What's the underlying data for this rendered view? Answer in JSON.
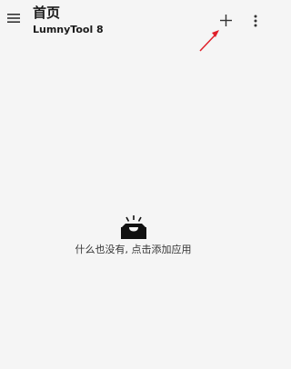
{
  "header": {
    "title": "首页",
    "subtitle": "LumnyTool 8"
  },
  "actions": {
    "menu_icon": "hamburger-menu-icon",
    "add_icon": "plus-icon",
    "more_icon": "more-vertical-icon"
  },
  "annotation": {
    "arrow_color": "#e0202a"
  },
  "empty_state": {
    "icon": "empty-inbox-icon",
    "message": "什么也没有, 点击添加应用"
  }
}
